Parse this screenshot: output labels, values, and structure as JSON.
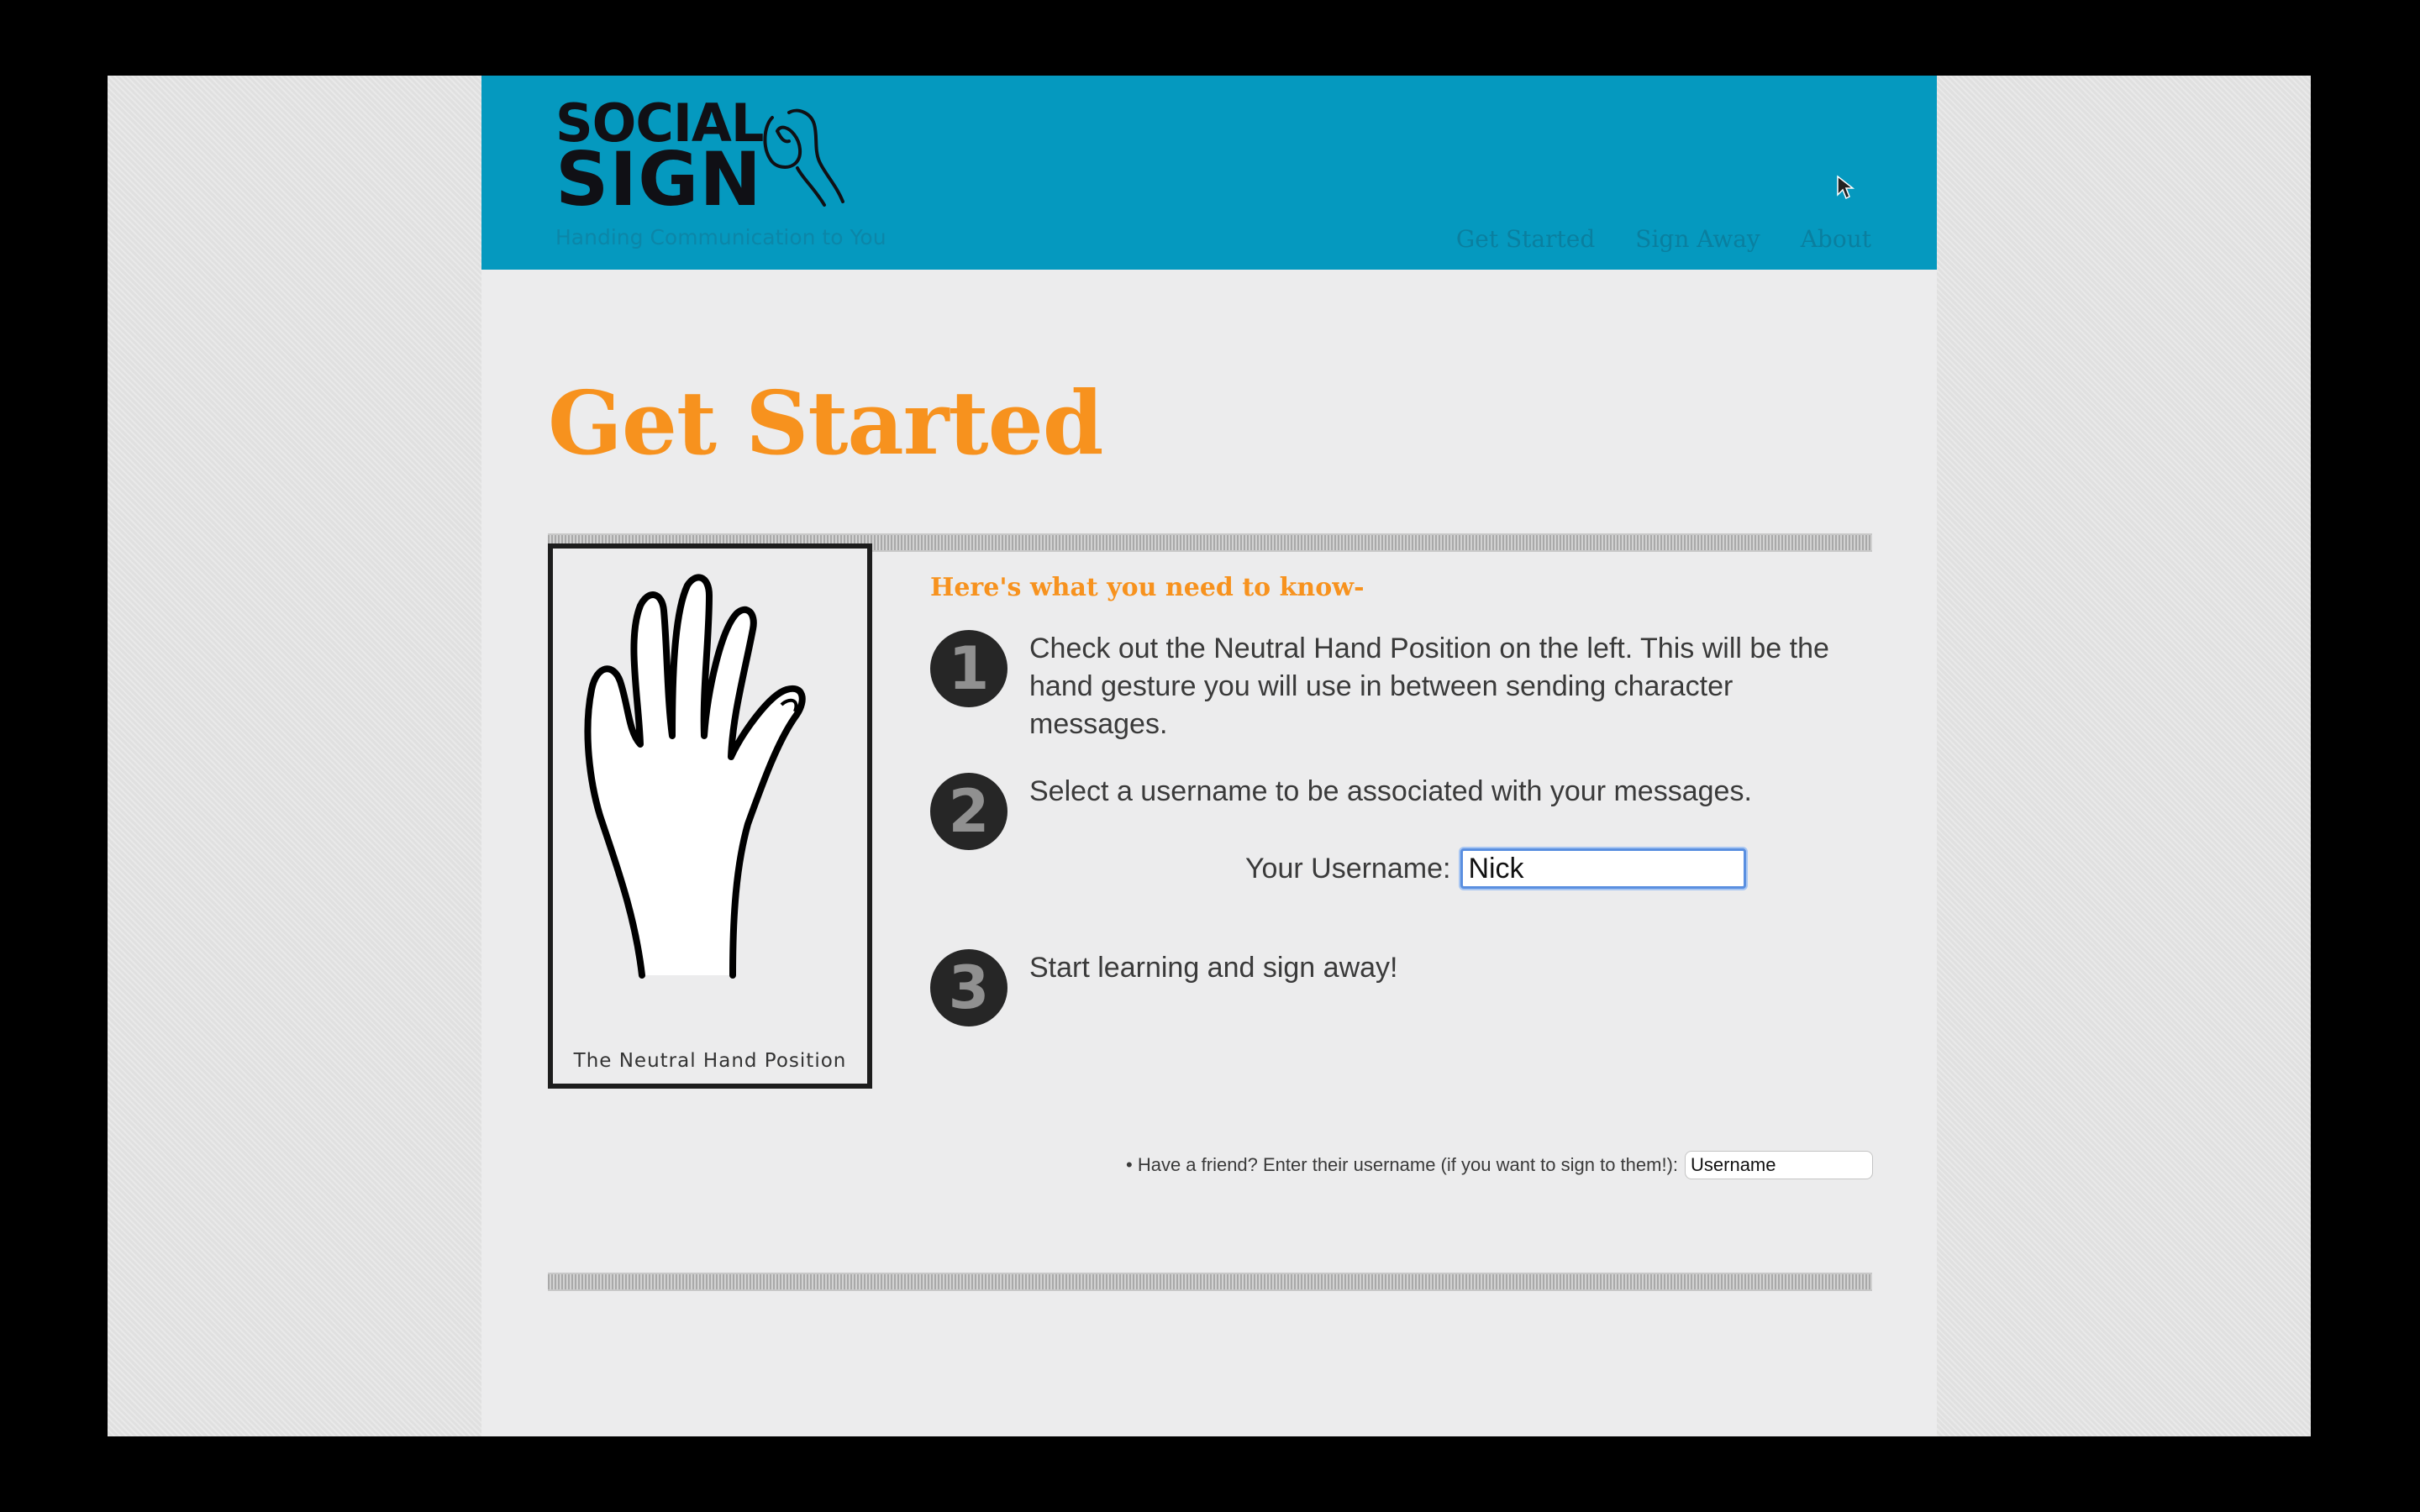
{
  "header": {
    "logo": {
      "line1": "SOCIAL",
      "line2": "SIGN"
    },
    "tagline": "Handing Communication to You",
    "nav": [
      {
        "label": "Get Started"
      },
      {
        "label": "Sign Away"
      },
      {
        "label": "About"
      }
    ]
  },
  "main": {
    "title": "Get Started",
    "hand_card": {
      "caption": "The Neutral Hand Position"
    },
    "intro": "Here's what you need to know-",
    "steps": [
      {
        "number": "1",
        "text": "Check out the Neutral Hand Position on the left. This will be the hand gesture you will use in between sending character messages."
      },
      {
        "number": "2",
        "text": "Select a username to be associated with your messages."
      },
      {
        "number": "3",
        "text": "Start learning and sign away!"
      }
    ],
    "username": {
      "label": "Your Username:",
      "value": "Nick"
    },
    "friend": {
      "label": "• Have a friend? Enter their username (if you want to sign to them!):",
      "placeholder": "Username"
    }
  },
  "colors": {
    "header_bg": "#0599bf",
    "accent_orange": "#f7921e",
    "badge_bg": "#262626"
  },
  "icons": [
    "hand-logo-icon",
    "open-hand-icon",
    "mouse-cursor-icon"
  ]
}
